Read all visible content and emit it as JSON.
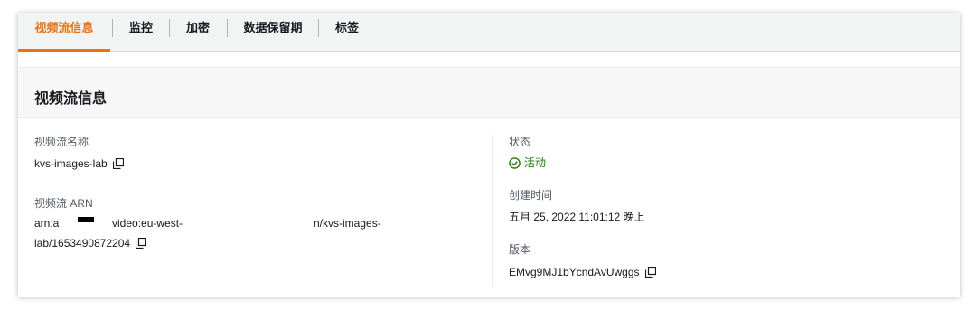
{
  "tabs": [
    {
      "label": "视频流信息",
      "active": true
    },
    {
      "label": "监控",
      "active": false
    },
    {
      "label": "加密",
      "active": false
    },
    {
      "label": "数据保留期",
      "active": false
    },
    {
      "label": "标签",
      "active": false
    }
  ],
  "panel": {
    "title": "视频流信息",
    "stream_name": {
      "label": "视频流名称",
      "value": "kvs-images-lab"
    },
    "stream_arn": {
      "label": "视频流 ARN",
      "line1_a": "arn:a",
      "line1_b": "video:eu-west-",
      "line1_c": "n/kvs-images-",
      "line2": "lab/1653490872204"
    },
    "status": {
      "label": "状态",
      "value": "活动"
    },
    "created": {
      "label": "创建时间",
      "value": "五月 25, 2022 11:01:12 晚上"
    },
    "version": {
      "label": "版本",
      "value": "EMvg9MJ1bYcndAvUwggs"
    }
  },
  "colors": {
    "accent": "#ec7211",
    "success": "#1d8102"
  },
  "icons": {
    "copy": "copy-icon",
    "status": "check-circle-icon"
  }
}
